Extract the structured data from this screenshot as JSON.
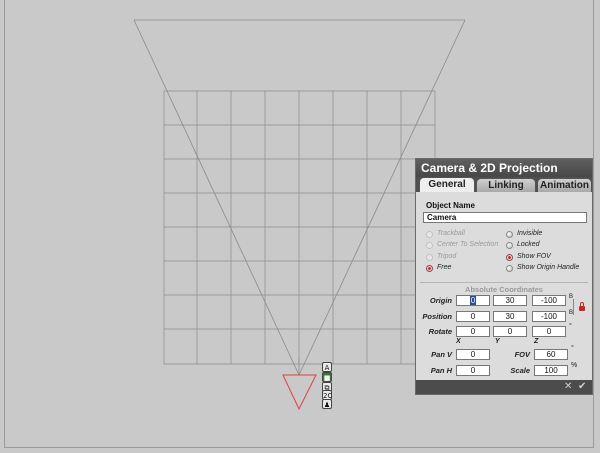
{
  "panel": {
    "title": "Camera & 2D Projection",
    "tabs": [
      {
        "label": "General",
        "active": true
      },
      {
        "label": "Linking",
        "active": false
      },
      {
        "label": "Animation",
        "active": false
      }
    ],
    "object_name_label": "Object Name",
    "object_name_value": "Camera",
    "options_left": [
      {
        "label": "Trackball",
        "enabled": false,
        "checked": false
      },
      {
        "label": "Center To Selection",
        "enabled": false,
        "checked": false
      },
      {
        "label": "Tripod",
        "enabled": false,
        "checked": false
      },
      {
        "label": "Free",
        "enabled": true,
        "checked": true
      }
    ],
    "options_right": [
      {
        "label": "Invisible",
        "checked": false
      },
      {
        "label": "Locked",
        "checked": false
      },
      {
        "label": "Show FOV",
        "checked": true
      },
      {
        "label": "Show Origin Handle",
        "checked": false
      }
    ],
    "abs_coords_label": "Absolute Coordinates",
    "rows": {
      "origin": {
        "label": "Origin",
        "x": "0",
        "y": "30",
        "z": "-100",
        "link": "B"
      },
      "position": {
        "label": "Position",
        "x": "0",
        "y": "30",
        "z": "-100",
        "link": "B"
      },
      "rotate": {
        "label": "Rotate",
        "x": "0",
        "y": "0",
        "z": "0",
        "unit": "°"
      }
    },
    "axis_labels": {
      "x": "X",
      "y": "Y",
      "z": "Z"
    },
    "pan_v": {
      "label": "Pan V",
      "value": "0"
    },
    "pan_h": {
      "label": "Pan H",
      "value": "0"
    },
    "fov": {
      "label": "FOV",
      "value": "60",
      "unit": "°"
    },
    "scale": {
      "label": "Scale",
      "value": "100",
      "unit": "%"
    },
    "footer_icons": [
      "close-icon",
      "checkmark-icon"
    ]
  },
  "camera_widgets": [
    "A",
    "■",
    "⧉",
    "2C",
    "♟"
  ],
  "colors": {
    "viewport_bg": "#c9c9c9",
    "grid_line": "#8a8a8a",
    "camera_marker": "#e04040",
    "panel_title_bg": "#4f4f4f",
    "checked_radio": "#c62828"
  }
}
